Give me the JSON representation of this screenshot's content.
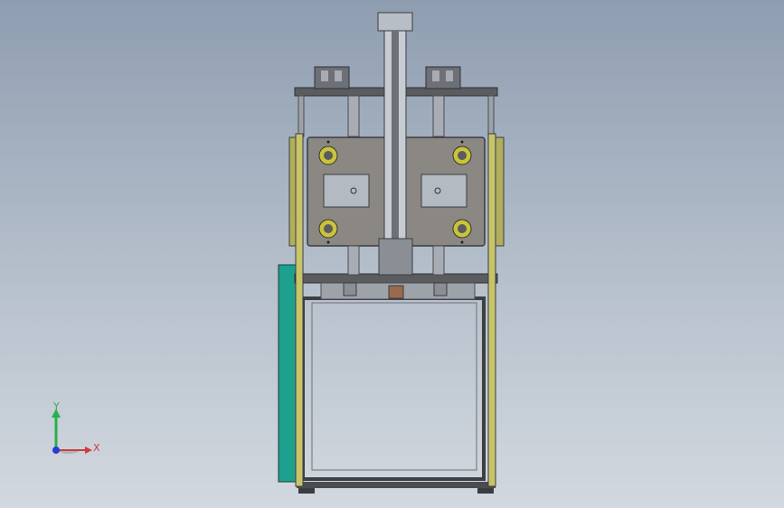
{
  "viewport": {
    "background_top": "#8e9db0",
    "background_bottom": "#d2d8df"
  },
  "model": {
    "frame_color": "#5c5e62",
    "plate_color": "#8b8883",
    "side_rail_color": "#c8c46a",
    "cover_color": "#1ea08f",
    "cylinder_color": "#c7ccd3",
    "coupler_color": "#9a6a4e",
    "bearing_color": "#c9c33a"
  },
  "triad": {
    "y_label": "Y",
    "x_label": "X",
    "y_color": "#2ab04a",
    "x_color": "#d23a3a",
    "z_color": "#2a3ad2"
  }
}
